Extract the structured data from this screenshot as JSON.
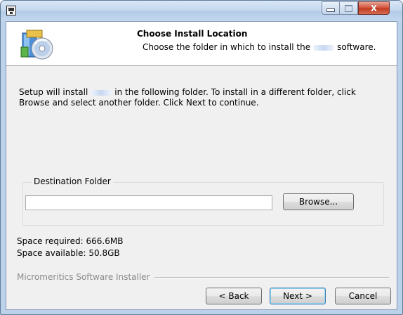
{
  "titlebar": {
    "icons": {
      "app": "setup-app-icon",
      "minimize": "minimize-icon",
      "maximize": "maximize-icon",
      "close": "close-icon"
    },
    "close_glyph": "X"
  },
  "header": {
    "title": "Choose Install Location",
    "subtitle_before": "Choose the folder in which to install the",
    "subtitle_after": "software.",
    "icon": "install-disk-icon"
  },
  "body": {
    "description_1": "Setup will install",
    "description_2": "in the following folder. To install in a different folder, click Browse and select another folder. Click Next to continue."
  },
  "destination": {
    "group_label": "Destination Folder",
    "path_value": "",
    "browse_label": "Browse..."
  },
  "space": {
    "required": "Space required: 666.6MB",
    "available": "Space available: 50.8GB"
  },
  "footer": {
    "branding": "Micromeritics Software Installer",
    "back_label": "< Back",
    "next_label": "Next >",
    "cancel_label": "Cancel"
  },
  "colors": {
    "accent": "#3c7fb1",
    "close_red": "#c23a22",
    "frame": "#bcd2ea"
  }
}
